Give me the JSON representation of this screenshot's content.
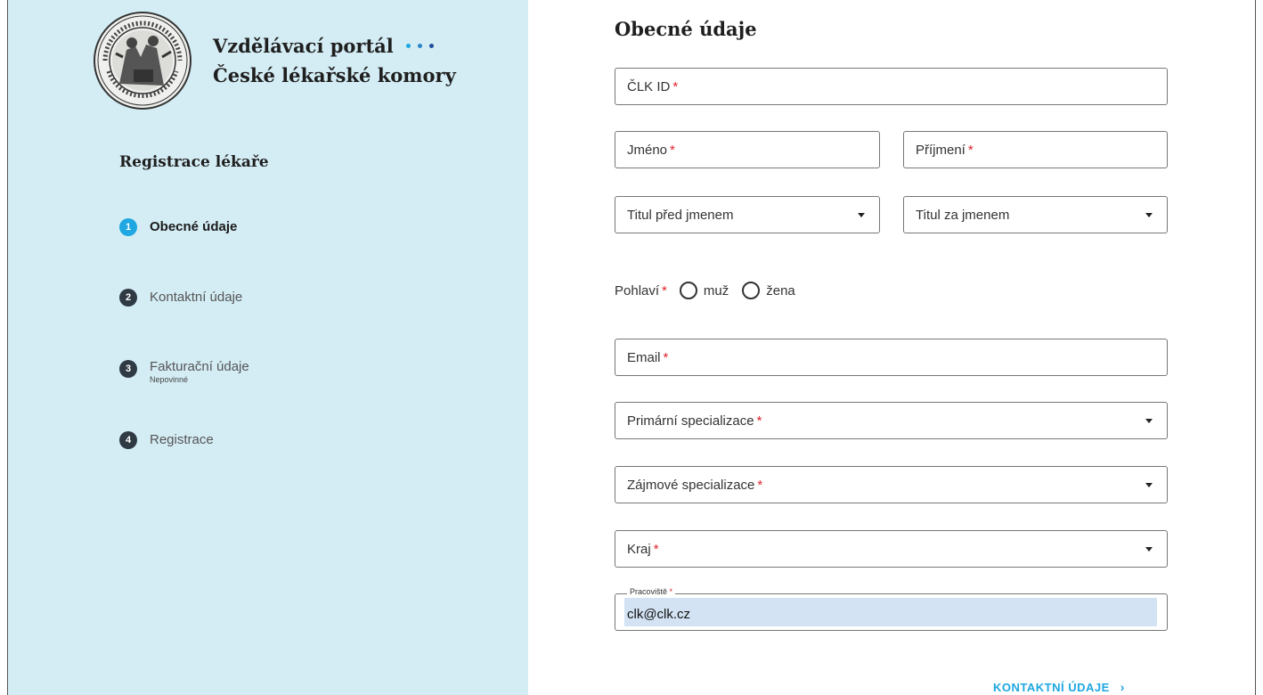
{
  "brand": {
    "line1": "Vzdělávací portál",
    "line2": "České lékařské komory",
    "dot_colors": [
      "#1ea7e1",
      "#2a86c8",
      "#1f4e9c"
    ]
  },
  "sidebar": {
    "title": "Registrace lékaře",
    "steps": [
      {
        "num": "1",
        "label": "Obecné údaje",
        "active": true
      },
      {
        "num": "2",
        "label": "Kontaktní údaje"
      },
      {
        "num": "3",
        "label": "Fakturační údaje",
        "sub": "Nepovinné"
      },
      {
        "num": "4",
        "label": "Registrace"
      }
    ]
  },
  "form": {
    "title": "Obecné údaje",
    "clk_id": "ČLK ID",
    "jmeno": "Jméno",
    "prijmeni": "Příjmení",
    "titul_pred": "Titul před jmenem",
    "titul_za": "Titul za jmenem",
    "pohlavi": "Pohlaví",
    "muz": "muž",
    "zena": "žena",
    "email": "Email",
    "primarni": "Primární specializace",
    "zajmove": "Zájmové specializace",
    "kraj": "Kraj",
    "pracoviste_label": "Pracoviště",
    "pracoviste_value": "clk@clk.cz",
    "required_mark": "*"
  },
  "next": {
    "label": "KONTAKTNÍ ÚDAJE",
    "chevron": "›"
  },
  "colors": {
    "sidebar_bg": "#d4edf5",
    "accent": "#1ea7e1",
    "required": "#e0232b",
    "autofill": "#d3e3f4"
  }
}
